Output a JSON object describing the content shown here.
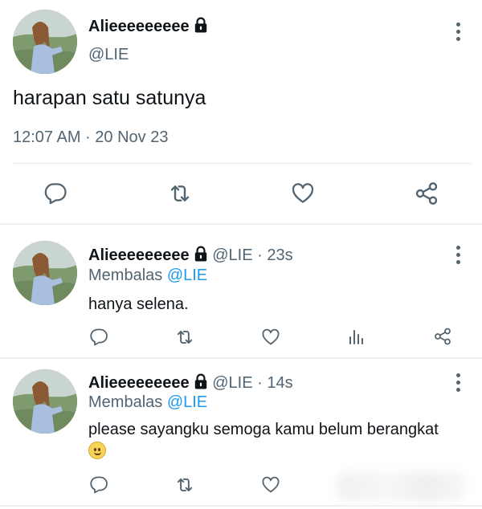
{
  "main_tweet": {
    "display_name": "Alieeeeeeeee",
    "handle": "@LIE",
    "text": "harapan satu satunya",
    "timestamp": "12:07 AM · 20 Nov 23",
    "actions": [
      "reply-icon",
      "retweet-icon",
      "like-icon",
      "share-icon"
    ]
  },
  "replies": [
    {
      "display_name": "Alieeeeeeeee",
      "handle": "@LIE",
      "time": "· 23s",
      "replying_prefix": "Membalas",
      "replying_to": "@LIE",
      "text": "hanya selena.",
      "actions": [
        "reply-icon",
        "retweet-icon",
        "like-icon",
        "analytics-icon",
        "share-icon"
      ]
    },
    {
      "display_name": "Alieeeeeeeee",
      "handle": "@LIE",
      "time": "· 14s",
      "replying_prefix": "Membalas",
      "replying_to": "@LIE",
      "text": "please sayangku semoga kamu belum berangkat",
      "emoji": "slightly-smiling-face",
      "actions": [
        "reply-icon",
        "retweet-icon",
        "like-icon"
      ]
    }
  ],
  "colors": {
    "text": "#0f1419",
    "muted": "#536471",
    "link": "#1d9bf0",
    "divider": "#e6e9ec"
  }
}
